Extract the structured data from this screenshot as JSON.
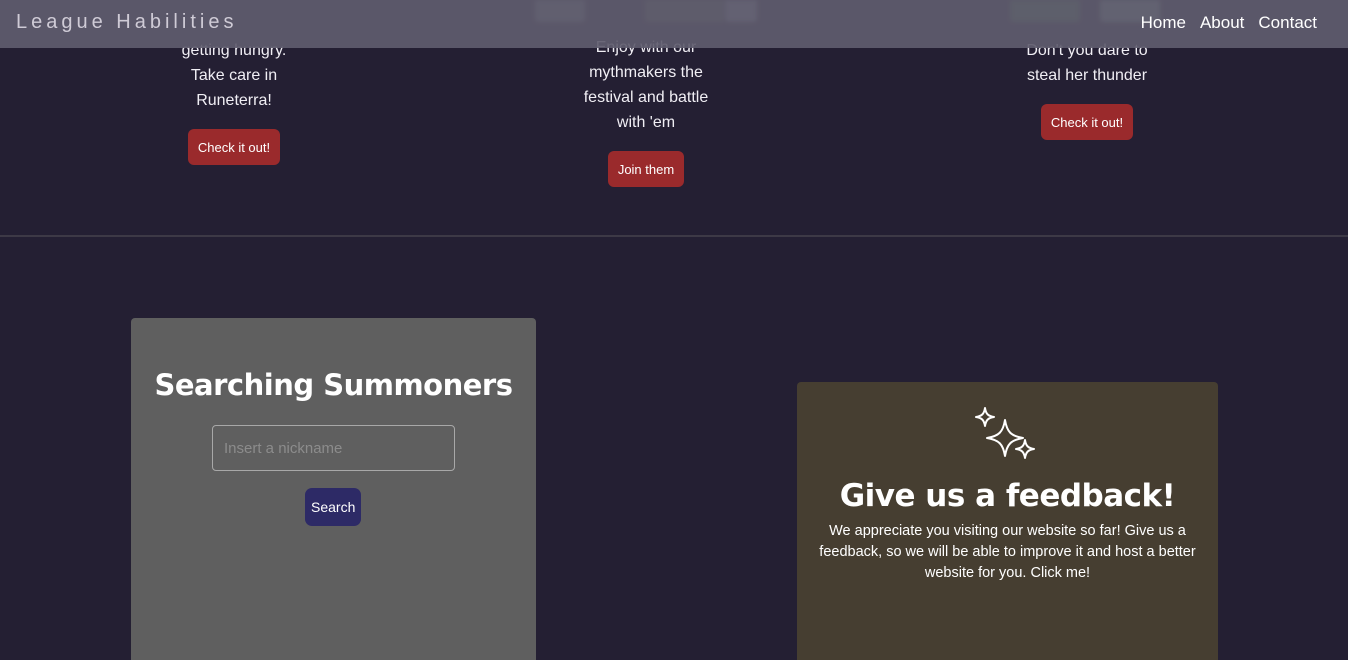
{
  "header": {
    "brand": "League Habilities",
    "nav": [
      "Home",
      "About",
      "Contact"
    ]
  },
  "cards": [
    {
      "lines": [
        "getting hungry.",
        "Take care in",
        "Runeterra!"
      ],
      "button": "Check it out!"
    },
    {
      "lines": [
        "Enjoy with our",
        "mythmakers the",
        "festival and battle",
        "with 'em"
      ],
      "button": "Join them"
    },
    {
      "lines": [
        "Don't you dare to",
        "steal her thunder"
      ],
      "button": "Check it out!"
    }
  ],
  "search": {
    "title": "Searching Summoners",
    "placeholder": "Insert a nickname",
    "button": "Search"
  },
  "feedback": {
    "icon": "sparkles-icon",
    "title": "Give us a feedback!",
    "text": "We appreciate you visiting our website so far! Give us a feedback, so we will be able to improve it and host a better website for you. Click me!"
  },
  "colors": {
    "background": "#241f33",
    "accent_red": "#9a2a2c",
    "search_button": "#2d2a66",
    "search_panel": "#5f5f5f",
    "feedback_panel": "#463e31"
  }
}
